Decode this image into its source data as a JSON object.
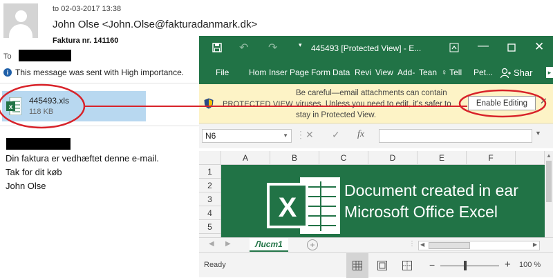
{
  "email": {
    "date": "to 02-03-2017 13:38",
    "from": "John Olse <John.Olse@fakturadanmark.dk>",
    "subject": "Faktura nr. 141160",
    "to_label": "To",
    "importance": "This message was sent with High importance.",
    "attachment": {
      "name": "445493.xls",
      "size": "118 KB"
    },
    "body_lines": [
      "Din faktura er vedhæftet denne e-mail.",
      "Tak for dit køb",
      "John Olse"
    ]
  },
  "excel": {
    "title": "445493  [Protected View] - E...",
    "ribbon_tabs": [
      "File",
      "Hom",
      "Inser",
      "Page",
      "Form",
      "Data",
      "Revi",
      "View",
      "Add-",
      "Tean",
      "Tell",
      "Pet..."
    ],
    "share_label": "Shar",
    "protected_view": {
      "label": "PROTECTED VIEW",
      "message": "Be careful—email attachments can contain viruses. Unless you need to edit, it's safer to stay in Protected View.",
      "button": "Enable Editing"
    },
    "namebox": "N6",
    "fx_label": "fx",
    "columns": [
      "A",
      "B",
      "C",
      "D",
      "E",
      "F"
    ],
    "rows": [
      "1",
      "2",
      "3",
      "4",
      "5"
    ],
    "banner_lines": [
      "Document created in ear",
      "Microsoft Office Excel"
    ],
    "sheet_tab": "Лист1",
    "status": "Ready",
    "zoom": "100 %",
    "zoom_percent": 100
  },
  "colors": {
    "excel_green": "#217346",
    "attachment_highlight": "#b8d8f0",
    "protected_view_bar": "#fdf3c6",
    "annotation_red": "#d8232a"
  }
}
